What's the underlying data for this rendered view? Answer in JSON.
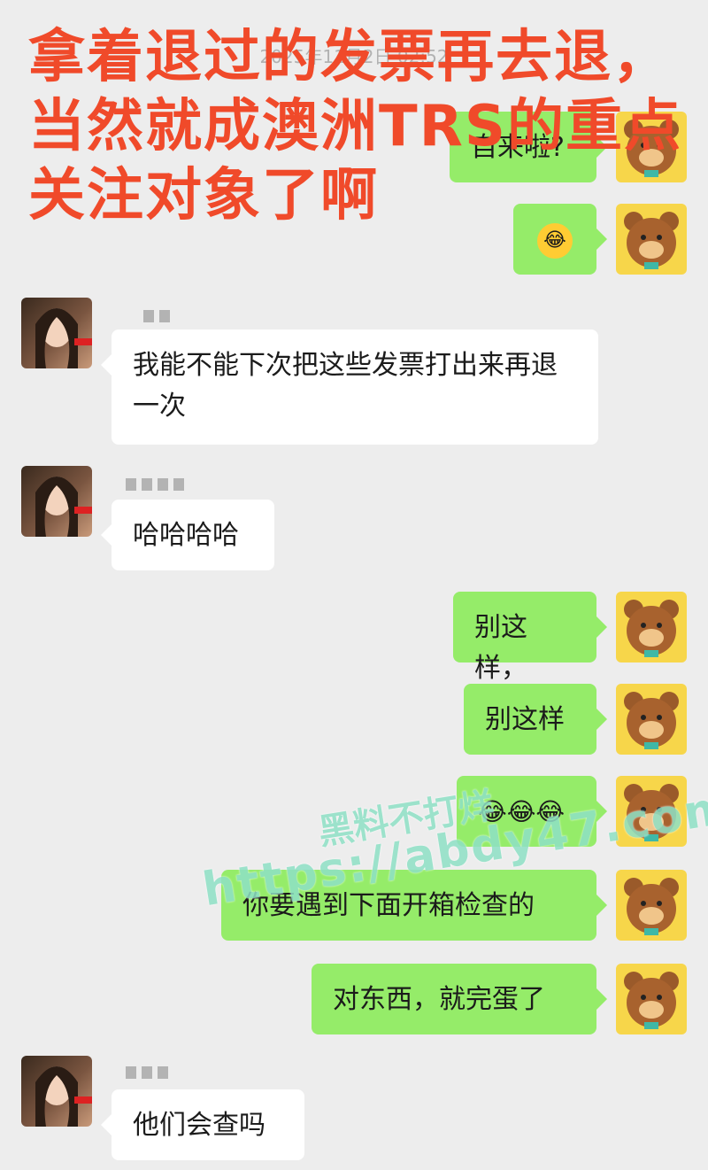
{
  "timestamp": "2025年11月2日 02:52",
  "overlay_title": "拿着退过的发票再去退，当然就成澳洲TRS的重点关注对象了啊",
  "messages": [
    {
      "side": "out",
      "text": "自来啦?"
    },
    {
      "side": "out",
      "text": "😂"
    },
    {
      "side": "in",
      "text": "我能不能下次把这些发票打出来再退一次"
    },
    {
      "side": "in",
      "text": "哈哈哈哈"
    },
    {
      "side": "out",
      "text": "别这样，"
    },
    {
      "side": "out",
      "text": "别这样"
    },
    {
      "side": "out",
      "text": "😂😂😂"
    },
    {
      "side": "out",
      "text": "你要遇到下面开箱检查的"
    },
    {
      "side": "out",
      "text": "对东西，就完蛋了"
    },
    {
      "side": "in",
      "text": "他们会查吗"
    }
  ],
  "watermark": {
    "line1": "黑料不打烊",
    "line2": "https://abdy47.com"
  },
  "colors": {
    "outgoing_bubble": "#95ec69",
    "incoming_bubble": "#ffffff",
    "background": "#ededed",
    "overlay_text": "#f04a2a"
  },
  "icons": {
    "outgoing_avatar": "bear-avatar-icon",
    "incoming_avatar": "girl-avatar-icon",
    "emoji": "tears-of-joy-emoji-icon"
  }
}
